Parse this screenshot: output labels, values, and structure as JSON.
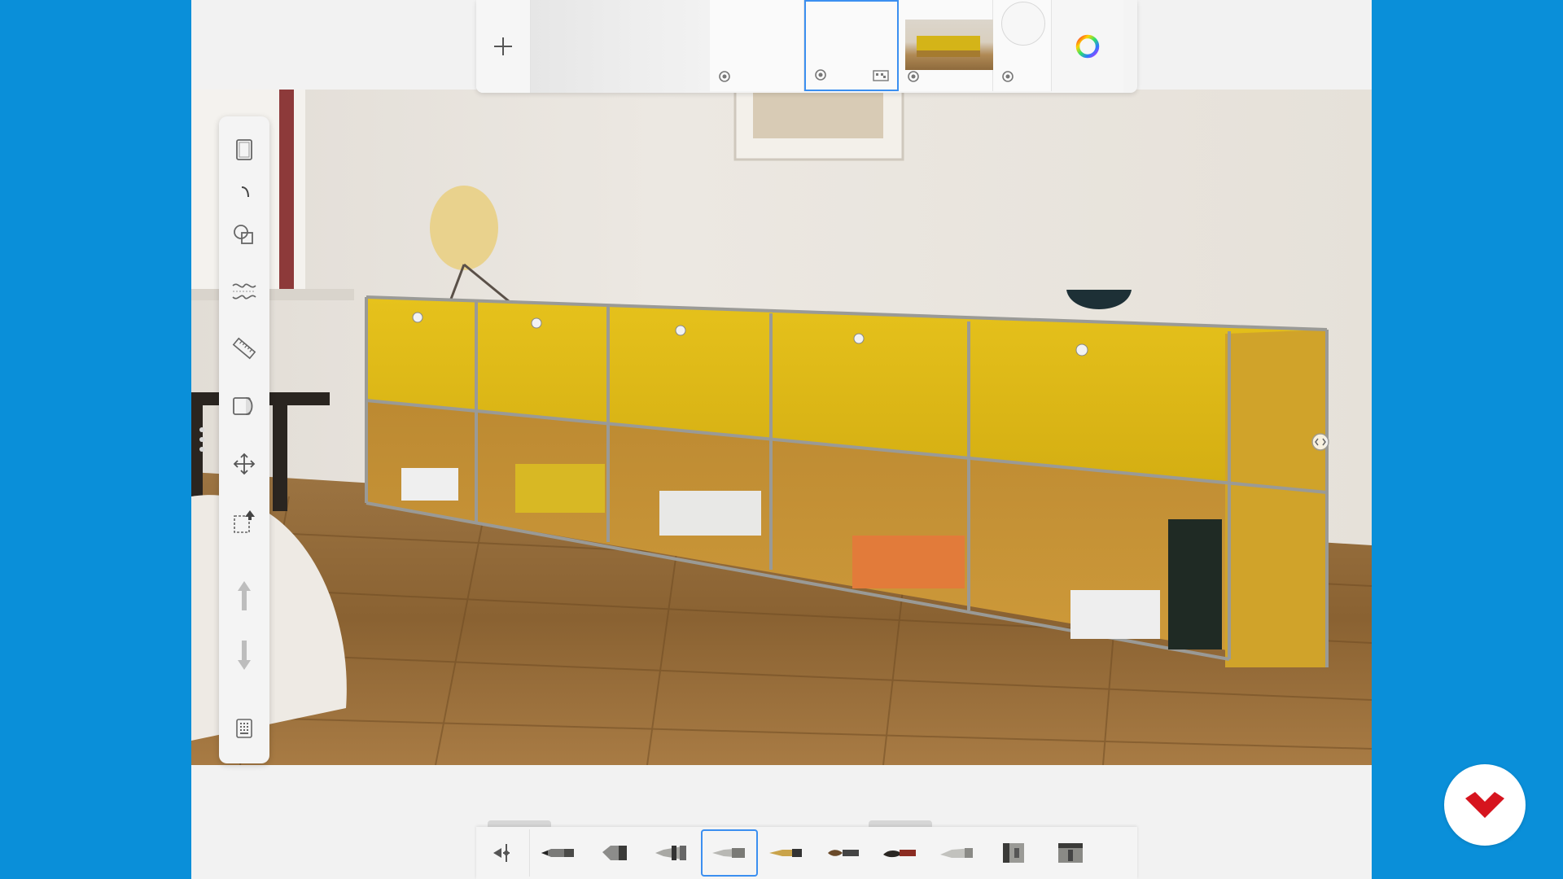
{
  "app": {
    "name": "sketch-canvas"
  },
  "layer_bar": {
    "add_icon": "plus-icon",
    "layers": [
      {
        "kind": "blank",
        "selected": false
      },
      {
        "kind": "empty",
        "selected": false,
        "icon": "visibility-pin-icon"
      },
      {
        "kind": "empty",
        "selected": true,
        "icon": "visibility-pin-icon",
        "blend_icon": "blend-mode-icon"
      },
      {
        "kind": "image",
        "selected": false,
        "icon": "visibility-pin-icon"
      },
      {
        "kind": "background",
        "selected": false,
        "icon": "visibility-pin-icon"
      }
    ],
    "color_icon": "color-wheel-icon"
  },
  "toolbar": {
    "tools": [
      "canvas-icon",
      "brush-stroke-icon",
      "shapes-icon",
      "symmetry-icon",
      "ruler-icon",
      "layer-transform-icon",
      "move-icon",
      "selection-icon",
      "undo-icon",
      "redo-icon",
      "more-icon"
    ]
  },
  "brushes": {
    "items": [
      "brush-settings-icon",
      "pencil-icon",
      "marker-icon",
      "airbrush-icon",
      "technical-pen-icon",
      "fountain-pen-icon",
      "round-brush-icon",
      "ink-brush-icon",
      "chisel-marker-icon",
      "flat-marker-icon",
      "wide-marker-icon"
    ],
    "selected_index": 4
  },
  "colors": {
    "accent": "#3b8ff0",
    "background": "#0a8fd9",
    "brand": "#d6141e"
  },
  "brand": {
    "icon": "brand-logo-icon"
  }
}
